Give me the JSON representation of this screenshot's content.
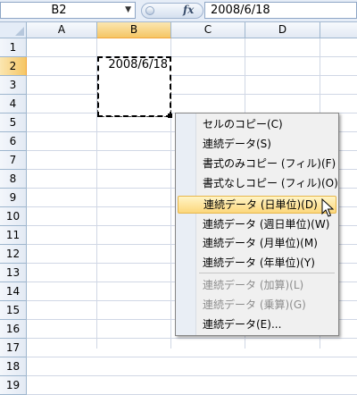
{
  "formula_bar": {
    "name_box": "B2",
    "fx_label": "fx",
    "formula_value": "2008/6/18"
  },
  "columns": [
    "A",
    "B",
    "C",
    "D"
  ],
  "rows": [
    "1",
    "2",
    "3",
    "4",
    "5",
    "6",
    "7",
    "8",
    "9",
    "10",
    "11",
    "12",
    "13",
    "14",
    "15",
    "16",
    "17",
    "18",
    "19"
  ],
  "cell_b2": "2008/6/18",
  "context_menu": {
    "items": [
      {
        "label": "セルのコピー(C)",
        "enabled": true
      },
      {
        "label": "連続データ(S)",
        "enabled": true
      },
      {
        "label": "書式のみコピー (フィル)(F)",
        "enabled": true
      },
      {
        "label": "書式なしコピー (フィル)(O)",
        "enabled": true
      },
      {
        "label": "連続データ (日単位)(D)",
        "enabled": true,
        "highlighted": true
      },
      {
        "label": "連続データ (週日単位)(W)",
        "enabled": true
      },
      {
        "label": "連続データ (月単位)(M)",
        "enabled": true
      },
      {
        "label": "連続データ (年単位)(Y)",
        "enabled": true
      },
      {
        "label": "連続データ (加算)(L)",
        "enabled": false
      },
      {
        "label": "連続データ (乗算)(G)",
        "enabled": false
      },
      {
        "label": "連続データ(E)...",
        "enabled": true
      }
    ]
  },
  "colors": {
    "selection_header": "#f5c665",
    "menu_highlight": "#fcd77c",
    "gridline": "#d0d7e5"
  }
}
